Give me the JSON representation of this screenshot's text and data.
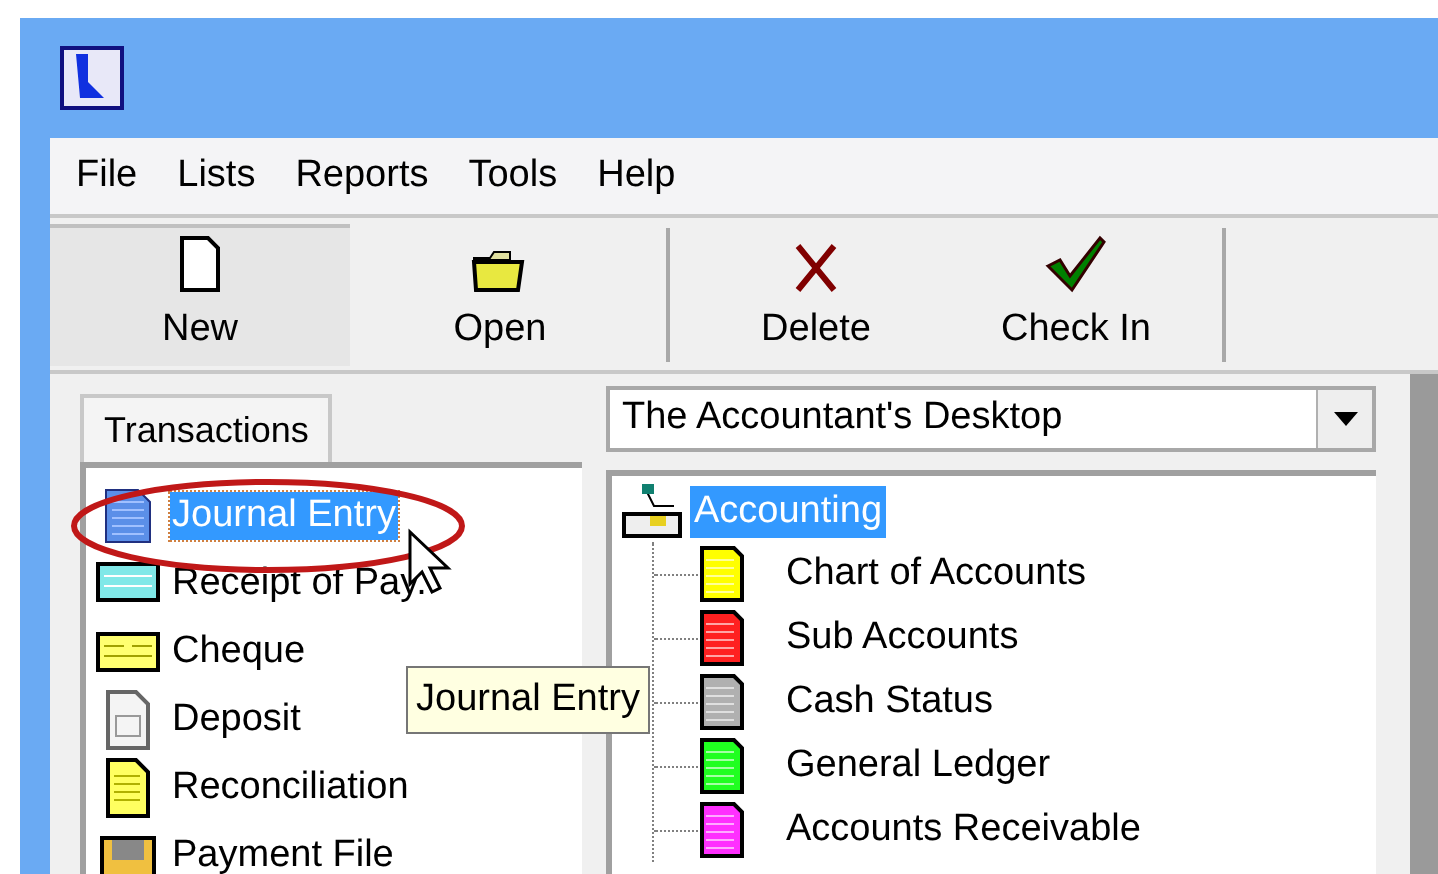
{
  "menu": [
    "File",
    "Lists",
    "Reports",
    "Tools",
    "Help"
  ],
  "toolbar": [
    {
      "label": "New",
      "kind": "new",
      "selected": true
    },
    {
      "label": "Open",
      "kind": "open",
      "selected": false
    },
    {
      "kind": "separator"
    },
    {
      "label": "Delete",
      "kind": "delete",
      "selected": false
    },
    {
      "label": "Check In",
      "kind": "checkin",
      "selected": false
    },
    {
      "kind": "separator"
    }
  ],
  "left_panel": {
    "tabs": [
      {
        "label": "Transactions",
        "selected": true
      }
    ],
    "items": [
      {
        "label": "Journal Entry",
        "kind": "journal",
        "selected": true
      },
      {
        "label": "Receipt of Pay.",
        "kind": "receipt",
        "selected": false
      },
      {
        "label": "Cheque",
        "kind": "cheque",
        "selected": false
      },
      {
        "label": "Deposit",
        "kind": "deposit",
        "selected": false
      },
      {
        "label": "Reconciliation",
        "kind": "ledger",
        "selected": false
      },
      {
        "label": "Payment File",
        "kind": "file",
        "selected": false
      }
    ]
  },
  "tooltip": "Journal Entry",
  "right_panel": {
    "combo": {
      "value": "The Accountant's Desktop"
    },
    "tree": {
      "label": "Accounting",
      "selected": true,
      "expanded": true,
      "children": [
        {
          "label": "Chart of Accounts",
          "color": "#ffff00"
        },
        {
          "label": "Sub Accounts",
          "color": "#ff2020"
        },
        {
          "label": "Cash Status",
          "color": "#b0b0b0"
        },
        {
          "label": "General Ledger",
          "color": "#20ff20"
        },
        {
          "label": "Accounts Receivable",
          "color": "#ff30ff"
        }
      ]
    }
  }
}
